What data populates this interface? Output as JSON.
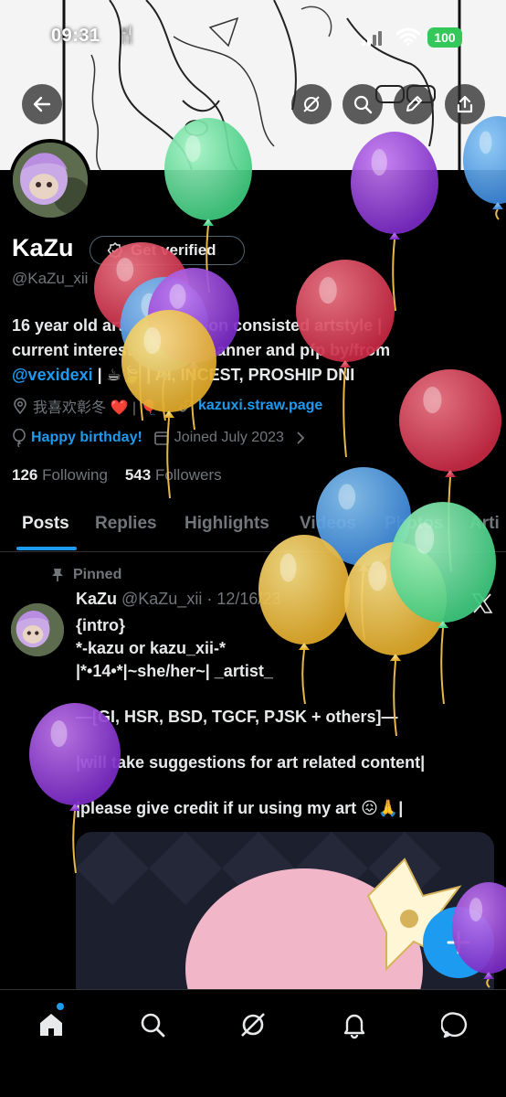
{
  "status_bar": {
    "time": "09:31",
    "time_suffix": "🍴",
    "battery": "100"
  },
  "profile": {
    "display_name": "KaZu",
    "verify_label": "Get verified",
    "handle": "@KaZu_xii",
    "bio_line1": "16 year old artist with a non consisted artstyle |",
    "bio_line2": "current interests below | banner and pfp by/from",
    "bio_link": "@vexidexi",
    "bio_line3_rest": " | ☕🍃 | AI, INCEST, PROSHIP DNI",
    "location": "我喜欢彰冬 ❤️ | 🎈 |",
    "website": "kazuxi.straw.page",
    "birthday": "Happy birthday!",
    "joined": "Joined July 2023",
    "following_count": "126",
    "following_label": "Following",
    "followers_count": "543",
    "followers_label": "Followers"
  },
  "tabs": [
    "Posts",
    "Replies",
    "Highlights",
    "Videos",
    "Photos",
    "Arti"
  ],
  "post": {
    "pinned_label": "Pinned",
    "author_name": "KaZu",
    "author_handle": "@KaZu_xii",
    "date": "· 12/16/23",
    "lines": [
      "{intro}",
      "*-kazu or kazu_xii-*",
      "|*•14•*|~she/her~| _artist_",
      "",
      "—[GI, HSR, BSD, TGCF, PJSK + others]—",
      "",
      "|will take suggestions for art related content|",
      "",
      "|please give credit if ur using my art 😖🙏|"
    ]
  },
  "colors": {
    "accent": "#1d9bf0",
    "battery": "#34c759",
    "muted": "#71767b"
  },
  "icons": [
    "back-arrow-icon",
    "grok-icon",
    "search-icon",
    "edit-pencil-icon",
    "share-icon",
    "location-icon",
    "link-icon",
    "balloon-icon",
    "calendar-icon",
    "pin-icon",
    "x-logo-icon",
    "plus-icon",
    "home-icon",
    "explore-icon",
    "bell-icon",
    "message-icon"
  ]
}
